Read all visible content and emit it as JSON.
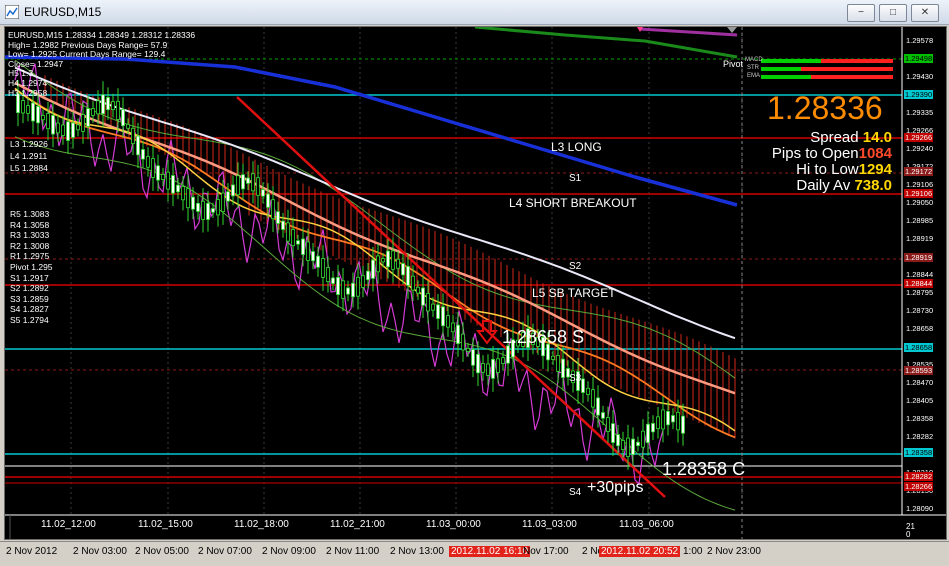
{
  "window": {
    "title": "EURUSD,M15",
    "btn_minimize": "−",
    "btn_restore": "□",
    "btn_close": "✕"
  },
  "header_lines": [
    "EURUSD,M15  1.28334 1.28349 1.28312 1.28336",
    "High= 1.2982    Previous Days Range= 57.9",
    "Low= 1.2925    Current Days Range= 129.4",
    "Close= 1.2947",
    "H5 1.3",
    "H4 1.2974",
    "H3 1.2958"
  ],
  "levels_lower": [
    "L3 1.2926",
    "L4 1.2911",
    "L5 1.2884"
  ],
  "pivots": [
    "R5 1.3083",
    "R4 1.3058",
    "R3 1.3033",
    "R2 1.3008",
    "R1 1.2975",
    "Pivot 1.295",
    "S1 1.2917",
    "S2 1.2892",
    "S3 1.2859",
    "S4 1.2827",
    "S5 1.2794"
  ],
  "panel": {
    "pivot_label": "Pivot",
    "ind_labels": [
      "MACD",
      "STR",
      "EMA"
    ],
    "price": "1.28336",
    "spread_label": "Spread",
    "spread_value": "14.0",
    "pto_label": "Pips to Open",
    "pto_value": "1084",
    "htl_label": "Hi to Low",
    "htl_value": "1294",
    "dav_label": "Daily Av",
    "dav_value": "738.0",
    "colors": {
      "price": "#ff8c00",
      "value": "#ffd700",
      "red": "#ff4a2a"
    }
  },
  "annotations": {
    "l3_long": "L3 LONG",
    "s1": "S1",
    "l4_short": "L4 SHORT BREAKOUT",
    "s2": "S2",
    "l5_target": "L5 SB TARGET",
    "short_entry": "1.28658 S",
    "s3": "S3",
    "close_exit": "1.28358 C",
    "s4": "S4",
    "pips": "+30pips"
  },
  "price_axis": [
    "1.29578",
    "1.29498",
    "1.29430",
    "1.29390",
    "1.29335",
    "1.29266",
    "1.29240",
    "1.29172",
    "1.29106",
    "1.29050",
    "1.28985",
    "1.28919",
    "1.28860",
    "1.28844",
    "1.28795",
    "1.28730",
    "1.28658",
    "1.28593",
    "1.28535",
    "1.28470",
    "1.28405",
    "1.28358",
    "1.28282",
    "1.28266",
    "1.28210",
    "1.28150",
    "1.28090"
  ],
  "price_axis_tags": [
    {
      "label": "1.29498",
      "color": "#00c000"
    },
    {
      "label": "1.29390",
      "color": "#00c8d0"
    },
    {
      "label": "1.29266",
      "color": "#c00000"
    },
    {
      "label": "1.29172",
      "color": "#8b1a1a"
    },
    {
      "label": "1.29106",
      "color": "#c00000"
    },
    {
      "label": "1.28919",
      "color": "#8b1a1a"
    },
    {
      "label": "1.28844",
      "color": "#c00000"
    },
    {
      "label": "1.28658",
      "color": "#00c8d0"
    },
    {
      "label": "1.28593",
      "color": "#8b1a1a"
    },
    {
      "label": "1.28358",
      "color": "#00c8d0"
    },
    {
      "label": "1.28282",
      "color": "#c00000"
    },
    {
      "label": "1.28266",
      "color": "#c00000"
    }
  ],
  "osc_axis": [
    "21",
    "0"
  ],
  "x_axis": [
    "11.02_12:00",
    "11.02_15:00",
    "11.02_18:00",
    "11.02_21:00",
    "11.03_00:00",
    "11.03_03:00",
    "11.03_06:00"
  ],
  "time_bar": [
    "2 Nov 2012",
    "2 Nov 03:00",
    "2 Nov 05:00",
    "2 Nov 07:00",
    "2 Nov 09:00",
    "2 Nov 11:00",
    "2 Nov 13:00",
    "2012.11.02 16:10",
    "Nov 17:00",
    "2 No",
    "2012.11.02 20:52",
    "1:00",
    "2 Nov 23:00"
  ]
}
